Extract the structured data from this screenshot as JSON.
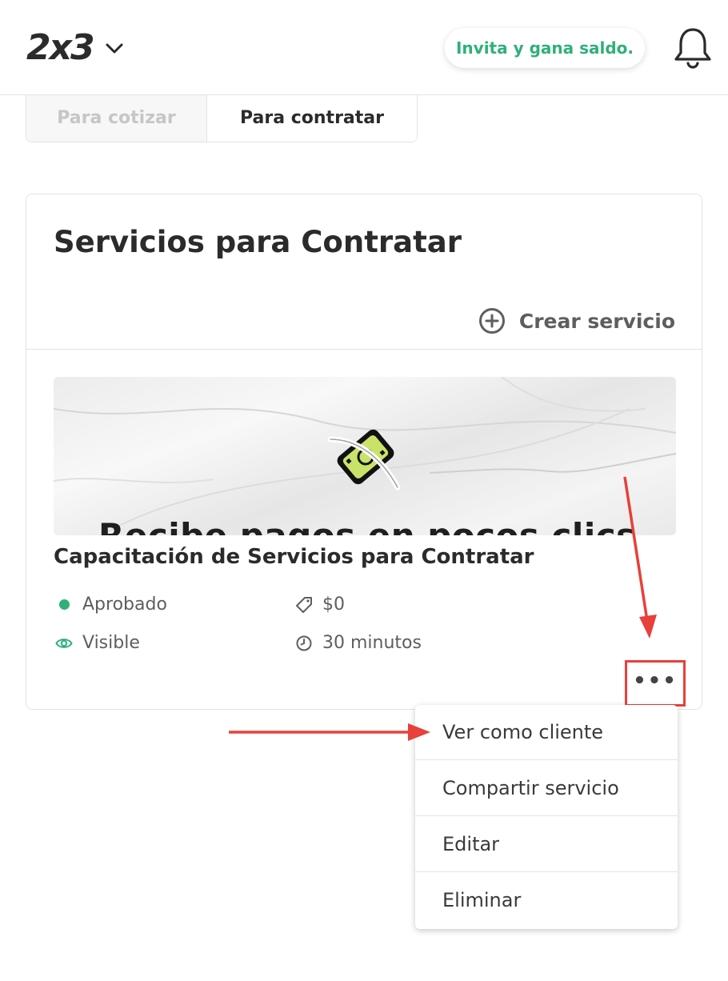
{
  "header": {
    "logo": "2x3",
    "invite_label": "Invita y gana saldo.",
    "accent_color": "#2fb07a"
  },
  "tabs": [
    {
      "label": "Para cotizar",
      "active": false
    },
    {
      "label": "Para contratar",
      "active": true
    }
  ],
  "card": {
    "title": "Servicios para Contratar",
    "create_label": "Crear servicio"
  },
  "service": {
    "image_text": "Recibe pagos en pocos clics",
    "title": "Capacitación de Servicios para Contratar",
    "status": "Aprobado",
    "price": "$0",
    "visibility": "Visible",
    "duration": "30 minutos",
    "more_label": "•••"
  },
  "menu": {
    "items": [
      "Ver como cliente",
      "Compartir servicio",
      "Editar",
      "Eliminar"
    ]
  },
  "annotation_color": "#e8403a"
}
